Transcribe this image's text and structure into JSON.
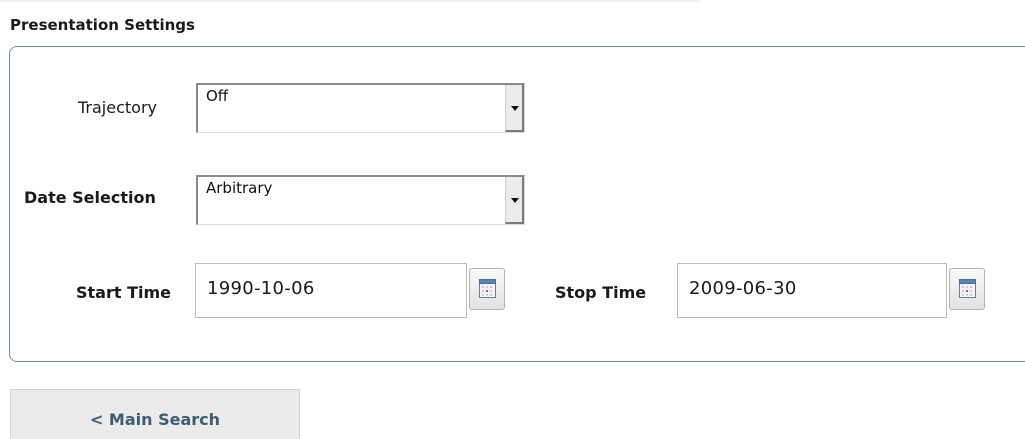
{
  "section": {
    "title": "Presentation Settings"
  },
  "trajectory": {
    "label": "Trajectory",
    "value": "Off"
  },
  "date_selection": {
    "label": "Date Selection",
    "value": "Arbitrary"
  },
  "start_time": {
    "label": "Start Time",
    "value": "1990-10-06"
  },
  "stop_time": {
    "label": "Stop Time",
    "value": "2009-06-30"
  },
  "nav": {
    "main_search_label": "< Main Search"
  },
  "colors": {
    "panel_border": "#6f8fa8",
    "button_text": "#3e5c74",
    "button_bg": "#ebebeb"
  }
}
